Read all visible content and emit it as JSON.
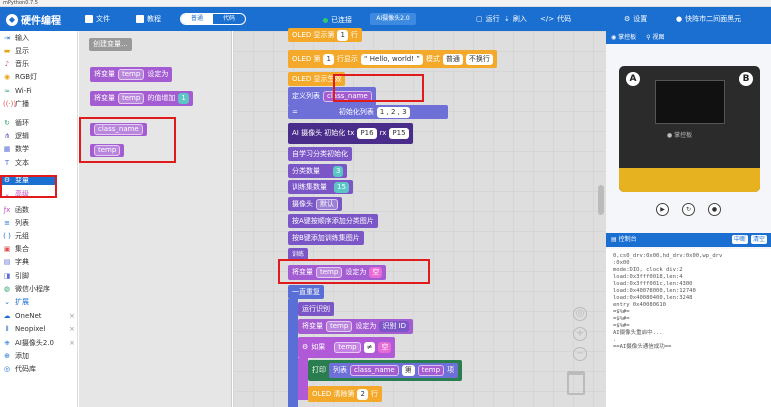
{
  "window": {
    "title": "mPython0.7.5"
  },
  "topbar": {
    "logo": "硬件编程",
    "file": "文件",
    "tutorial": "教程",
    "mode_normal": "普通",
    "mode_code": "代码",
    "connection": "已连接",
    "device": "AI摄像头2.0",
    "run": "运行",
    "flash": "刷入",
    "code": "代码",
    "settings": "设置",
    "user": "快阵市二间面黑元"
  },
  "sidebar": {
    "items": [
      {
        "label": "输入",
        "icon": "input-icon",
        "color": "#1b6fd1"
      },
      {
        "label": "显示",
        "icon": "display-icon",
        "color": "#e7a51a"
      },
      {
        "label": "音乐",
        "icon": "music-icon",
        "color": "#e0504f"
      },
      {
        "label": "RGB灯",
        "icon": "bulb-icon",
        "color": "#e7a51a"
      },
      {
        "label": "Wi-Fi",
        "icon": "wifi-icon",
        "color": "#2ca56a"
      },
      {
        "label": "广播",
        "icon": "broadcast-icon",
        "color": "#e0504f"
      },
      {
        "label": "循环",
        "icon": "loop-icon",
        "color": "#2ca56a"
      },
      {
        "label": "逻辑",
        "icon": "logic-icon",
        "color": "#7b56c6"
      },
      {
        "label": "数学",
        "icon": "math-icon",
        "color": "#5a6fd6"
      },
      {
        "label": "文本",
        "icon": "text-icon",
        "color": "#5a6fd6"
      },
      {
        "label": "变量",
        "icon": "variable-icon",
        "color": "#a35cd1"
      },
      {
        "label": "高级",
        "icon": "chevron-down-icon",
        "color": "#c04cc0"
      },
      {
        "label": "函数",
        "icon": "function-icon",
        "color": "#c04cc0"
      },
      {
        "label": "列表",
        "icon": "list-icon",
        "color": "#1b6fd1"
      },
      {
        "label": "元组",
        "icon": "tuple-icon",
        "color": "#1b6fd1"
      },
      {
        "label": "集合",
        "icon": "set-icon",
        "color": "#e0504f"
      },
      {
        "label": "字典",
        "icon": "dict-icon",
        "color": "#5a6fd6"
      },
      {
        "label": "引脚",
        "icon": "pin-icon",
        "color": "#5a6fd6"
      },
      {
        "label": "微信小程序",
        "icon": "wechat-icon",
        "color": "#2ca56a"
      },
      {
        "label": "扩展",
        "icon": "chevron-down-icon",
        "color": "#1b6fd1"
      },
      {
        "label": "OneNet",
        "icon": "cloud-icon",
        "color": "#1b6fd1"
      },
      {
        "label": "Neopixel",
        "icon": "neopixel-icon",
        "color": "#1b6fd1"
      },
      {
        "label": "AI摄像头2.0",
        "icon": "camera-icon",
        "color": "#1b6fd1"
      },
      {
        "label": "添加",
        "icon": "add-icon",
        "color": "#1b6fd1"
      },
      {
        "label": "代码库",
        "icon": "codelib-icon",
        "color": "#1b6fd1"
      }
    ]
  },
  "flyout": {
    "create_var": "创建变量...",
    "set_var": "将变量",
    "set_to": "设定为",
    "change_by": "的值增加",
    "change_amount": "1",
    "var_temp": "temp",
    "var_class": "class_name"
  },
  "workspace": {
    "oled1": "OLED 显示第",
    "oled1_line": "1",
    "oled1_end": "行",
    "oled2_a": "OLED 第",
    "oled2_line": "1",
    "oled2_b": "行显示",
    "oled2_text": "Hello, world!",
    "oled2_mode": "模式",
    "oled2_mode_val": "普通",
    "oled2_wrap": "不换行",
    "oled3": "OLED 显示生效",
    "def_list": "定义列表",
    "def_list_var": "class_name",
    "eq": "=",
    "init_list": "初始化列表",
    "init_vals": "1 , 2 , 3",
    "ai_init": "AI 摄像头 初始化 tx",
    "tx_pin": "P16",
    "rx_label": "rx",
    "rx_pin": "P15",
    "self_learn": "自学习分类初始化",
    "class_count": "分类数量",
    "class_count_val": "3",
    "train_count": "训练集数量",
    "train_count_val": "15",
    "camera": "摄像头",
    "camera_val": "默认",
    "add_by_a": "按A键按顺序添加分类图片",
    "add_by_b": "按B键添加训练集图片",
    "train": "训练",
    "set_var": "将变量",
    "set_var_name": "temp",
    "set_to": "设定为",
    "set_val": "空",
    "forever": "一直重复",
    "run_recog": "运行识别",
    "set_var2": "将变量",
    "set_var2_name": "temp",
    "set_to2": "设定为",
    "recog_id": "识别 ID",
    "if": "如果",
    "if_var": "temp",
    "neq": "≠",
    "empty": "空",
    "print": "打印",
    "list_label": "列表",
    "list_var": "class_name",
    "index": "第",
    "index_var": "temp",
    "item": "项",
    "oled_clear": "OLED 清除第",
    "oled_clear_line": "2",
    "oled_clear_end": "行"
  },
  "rightpane": {
    "tab_board": "掌控板",
    "tab_view": "视图",
    "console_title": "控制台",
    "console_btn1": "中断",
    "console_btn2": "清空",
    "console_text": "0,cs0_drv:0x00,hd_drv:0x00,wp_drv\n:0x00\nmode:DIO, clock div:2\nload:0x3fff0018,len:4\nload:0x3fff001c,len:4300\nload:0x40078000,len:12740\nload:0x40080400,len:3248\nentry 0x40080610\n=$%#=\n=$%#=\n=$%#=\nAI摄像头重启中...\n.\n==AI摄像头通信成功=="
  }
}
